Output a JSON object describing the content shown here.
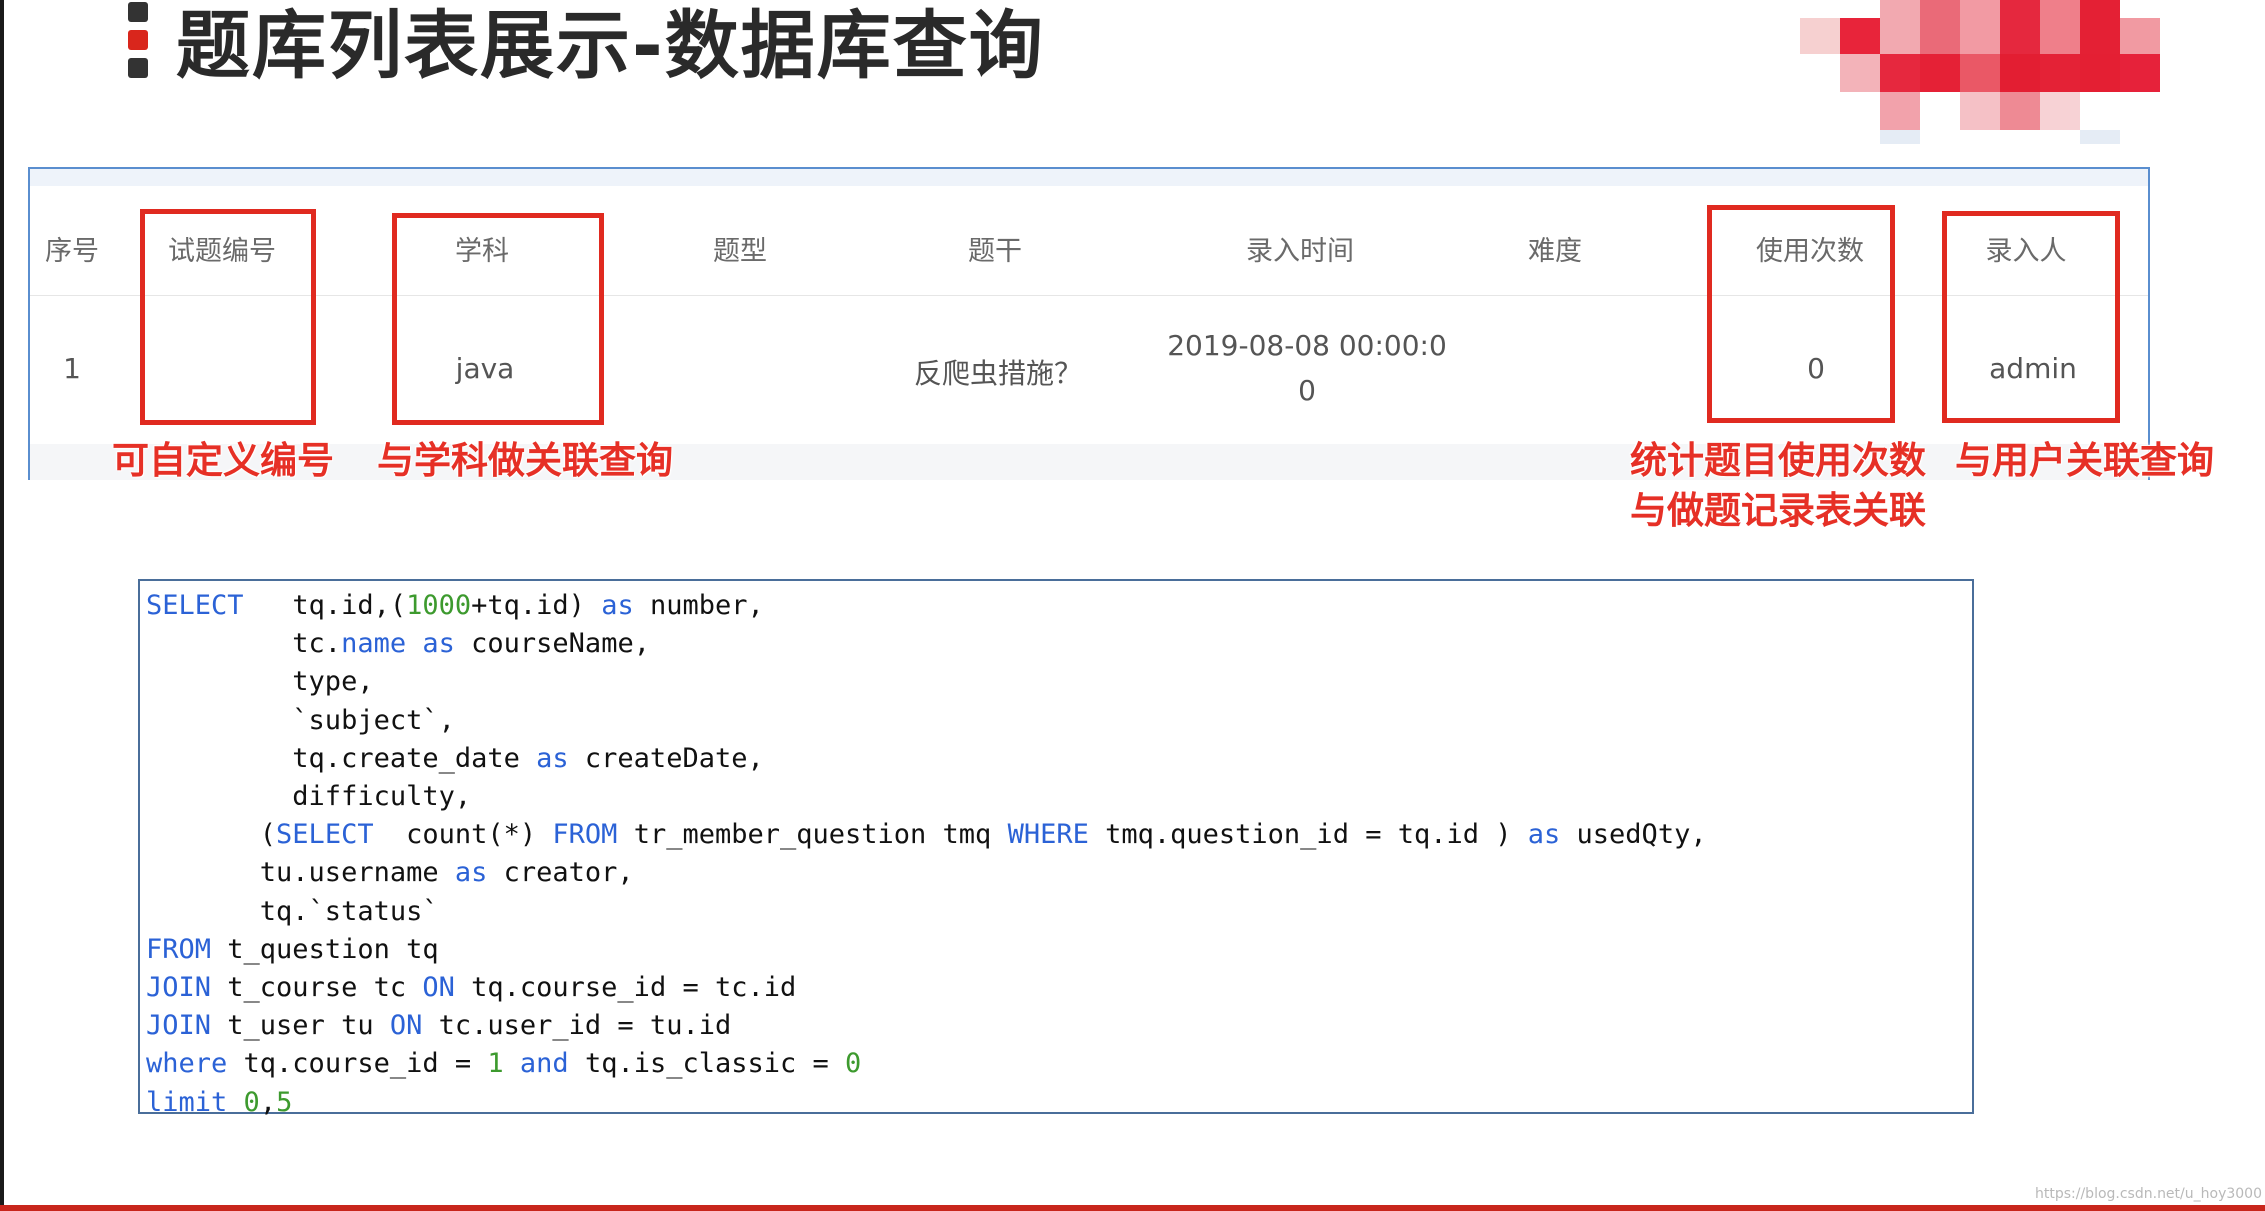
{
  "title": "题库列表展示-数据库查询",
  "table": {
    "headers": [
      "序号",
      "试题编号",
      "学科",
      "题型",
      "题干",
      "录入时间",
      "难度",
      "使用次数",
      "录入人"
    ],
    "row": {
      "index": "1",
      "number": "",
      "subject": "java",
      "type": "",
      "stem": "反爬虫措施？",
      "create_date_line1": "2019-08-08 00:00:0",
      "create_date_line2": "0",
      "difficulty": "",
      "used_count": "0",
      "creator": "admin"
    }
  },
  "annotations": {
    "custom_number": "可自定义编号",
    "subject_join": "与学科做关联查询",
    "usage_count_line1": "统计题目使用次数",
    "usage_count_line2": "与做题记录表关联",
    "user_join": "与用户关联查询"
  },
  "sql": [
    [
      {
        "t": "SELECT",
        "c": "kw"
      },
      {
        "t": "   tq.id,("
      },
      {
        "t": "1000",
        "c": "num"
      },
      {
        "t": "+tq.id) "
      },
      {
        "t": "as",
        "c": "kw"
      },
      {
        "t": " number,"
      }
    ],
    [
      {
        "t": "         tc."
      },
      {
        "t": "name",
        "c": "kw"
      },
      {
        "t": " "
      },
      {
        "t": "as",
        "c": "kw"
      },
      {
        "t": " courseName,"
      }
    ],
    [
      {
        "t": "         type,"
      }
    ],
    [
      {
        "t": "         `subject`,"
      }
    ],
    [
      {
        "t": "         tq.create_date "
      },
      {
        "t": "as",
        "c": "kw"
      },
      {
        "t": " createDate,"
      }
    ],
    [
      {
        "t": "         difficulty,"
      }
    ],
    [
      {
        "t": "       ("
      },
      {
        "t": "SELECT",
        "c": "kw"
      },
      {
        "t": "  count(*) "
      },
      {
        "t": "FROM",
        "c": "kw"
      },
      {
        "t": " tr_member_question tmq "
      },
      {
        "t": "WHERE",
        "c": "kw"
      },
      {
        "t": " tmq.question_id = tq.id ) "
      },
      {
        "t": "as",
        "c": "kw"
      },
      {
        "t": " usedQty,"
      }
    ],
    [
      {
        "t": "       tu.username "
      },
      {
        "t": "as",
        "c": "kw"
      },
      {
        "t": " creator,"
      }
    ],
    [
      {
        "t": "       tq.`status`"
      }
    ],
    [
      {
        "t": "FROM",
        "c": "kw"
      },
      {
        "t": " t_question tq"
      }
    ],
    [
      {
        "t": "JOIN",
        "c": "kw"
      },
      {
        "t": " t_course tc "
      },
      {
        "t": "ON",
        "c": "kw"
      },
      {
        "t": " tq.course_id = tc.id"
      }
    ],
    [
      {
        "t": "JOIN",
        "c": "kw"
      },
      {
        "t": " t_user tu "
      },
      {
        "t": "ON",
        "c": "kw"
      },
      {
        "t": " tc.user_id = tu.id"
      }
    ],
    [
      {
        "t": "where",
        "c": "kw"
      },
      {
        "t": " tq.course_id = "
      },
      {
        "t": "1",
        "c": "num"
      },
      {
        "t": " "
      },
      {
        "t": "and",
        "c": "kw"
      },
      {
        "t": " tq.is_classic = "
      },
      {
        "t": "0",
        "c": "num"
      }
    ],
    [
      {
        "t": "limit",
        "c": "kw"
      },
      {
        "t": " "
      },
      {
        "t": "0",
        "c": "num"
      },
      {
        "t": ","
      },
      {
        "t": "5",
        "c": "num"
      }
    ]
  ],
  "colors": {
    "accent_red": "#e02a20",
    "sql_keyword": "#2b62d6",
    "sql_number": "#3d9a2e",
    "frame_blue": "#5a8ecf"
  },
  "watermark": "https://blog.csdn.net/u_hoy3000"
}
